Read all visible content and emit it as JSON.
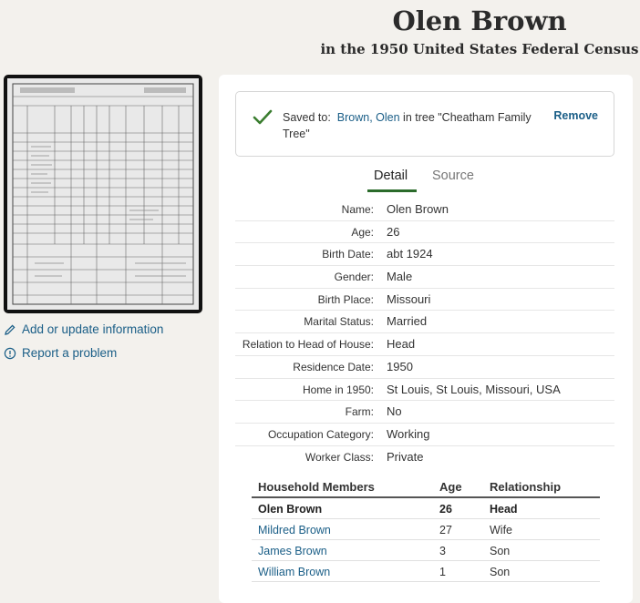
{
  "header": {
    "title": "Olen Brown",
    "subtitle": "in the 1950 United States Federal Census"
  },
  "sidebar": {
    "links": [
      {
        "label": "Add or update information",
        "icon": "pencil-icon"
      },
      {
        "label": "Report a problem",
        "icon": "alert-circle-icon"
      }
    ]
  },
  "saved": {
    "prefix": "Saved to:",
    "person_link": "Brown, Olen",
    "suffix": " in tree \"Cheatham Family Tree\"",
    "remove_label": "Remove",
    "check_color": "#3a7d2f"
  },
  "tabs": [
    {
      "label": "Detail",
      "active": true
    },
    {
      "label": "Source",
      "active": false
    }
  ],
  "details": [
    {
      "label": "Name:",
      "value": "Olen Brown"
    },
    {
      "label": "Age:",
      "value": "26"
    },
    {
      "label": "Birth Date:",
      "value": "abt 1924"
    },
    {
      "label": "Gender:",
      "value": "Male"
    },
    {
      "label": "Birth Place:",
      "value": "Missouri"
    },
    {
      "label": "Marital Status:",
      "value": "Married"
    },
    {
      "label": "Relation to Head of House:",
      "value": "Head"
    },
    {
      "label": "Residence Date:",
      "value": "1950"
    },
    {
      "label": "Home in 1950:",
      "value": "St Louis, St Louis, Missouri, USA"
    },
    {
      "label": "Farm:",
      "value": "No"
    },
    {
      "label": "Occupation Category:",
      "value": "Working"
    },
    {
      "label": "Worker Class:",
      "value": "Private"
    }
  ],
  "household": {
    "headers": [
      "Household Members",
      "Age",
      "Relationship"
    ],
    "rows": [
      {
        "name": "Olen Brown",
        "age": "26",
        "relationship": "Head",
        "is_link": false
      },
      {
        "name": "Mildred Brown",
        "age": "27",
        "relationship": "Wife",
        "is_link": true
      },
      {
        "name": "James Brown",
        "age": "3",
        "relationship": "Son",
        "is_link": true
      },
      {
        "name": "William Brown",
        "age": "1",
        "relationship": "Son",
        "is_link": true
      }
    ]
  },
  "colors": {
    "link": "#1a5e87",
    "accent_green": "#2b6b2b",
    "page_bg": "#f3f1ed"
  }
}
